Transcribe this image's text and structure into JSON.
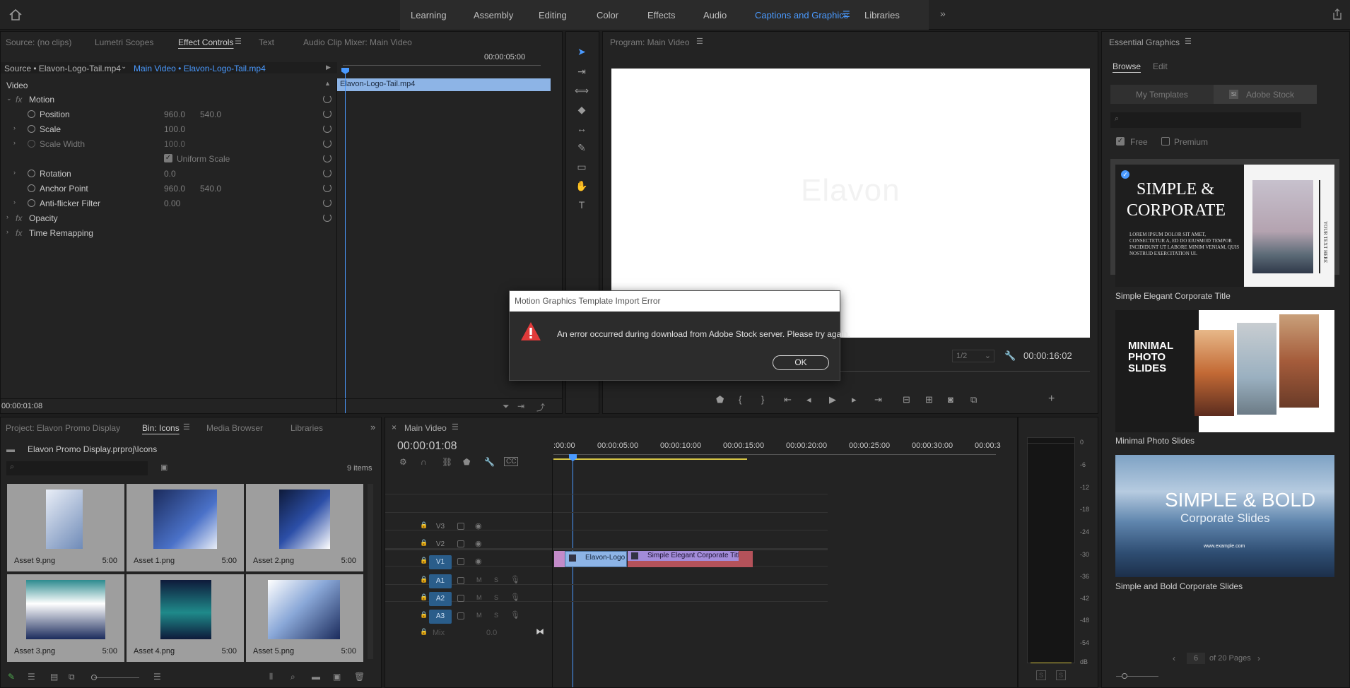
{
  "workspaces": {
    "tabs": [
      "Learning",
      "Assembly",
      "Editing",
      "Color",
      "Effects",
      "Audio",
      "Captions and Graphics",
      "Libraries"
    ],
    "active": "Captions and Graphics"
  },
  "source_panel": {
    "tabs": [
      "Source: (no clips)",
      "Lumetri Scopes",
      "Effect Controls",
      "Text",
      "Audio Clip Mixer: Main Video"
    ],
    "source_label": "Source • Elavon-Logo-Tail.mp4",
    "sequence_label": "Main Video • Elavon-Logo-Tail.mp4",
    "ruler_tc": "00:00:05:00",
    "clip_label": "Elavon-Logo-Tail.mp4",
    "current_tc": "00:00:01:08",
    "video_label": "Video",
    "rows": {
      "motion": "Motion",
      "position": "Position",
      "position_x": "960.0",
      "position_y": "540.0",
      "scale": "Scale",
      "scale_v": "100.0",
      "scale_width": "Scale Width",
      "scale_width_v": "100.0",
      "uniform_scale": "Uniform Scale",
      "rotation": "Rotation",
      "rotation_v": "0.0",
      "anchor": "Anchor Point",
      "anchor_x": "960.0",
      "anchor_y": "540.0",
      "antiflicker": "Anti-flicker Filter",
      "antiflicker_v": "0.00",
      "opacity": "Opacity",
      "time_remap": "Time Remapping"
    }
  },
  "program": {
    "title": "Program: Main Video",
    "watermark": "Elavon",
    "zoom": "1/2",
    "duration_tc": "00:00:16:02"
  },
  "project": {
    "tabs": [
      "Project: Elavon Promo Display",
      "Bin: Icons",
      "Media Browser",
      "Libraries"
    ],
    "path": "Elavon Promo Display.prproj\\Icons",
    "count": "9 items",
    "assets": [
      {
        "name": "Asset 9.png",
        "dur": "5:00"
      },
      {
        "name": "Asset 1.png",
        "dur": "5:00"
      },
      {
        "name": "Asset 2.png",
        "dur": "5:00"
      },
      {
        "name": "Asset 3.png",
        "dur": "5:00"
      },
      {
        "name": "Asset 4.png",
        "dur": "5:00"
      },
      {
        "name": "Asset 5.png",
        "dur": "5:00"
      }
    ]
  },
  "timeline": {
    "title": "Main Video",
    "tc": "00:00:01:08",
    "ruler": [
      ":00:00",
      "00:00:05:00",
      "00:00:10:00",
      "00:00:15:00",
      "00:00:20:00",
      "00:00:25:00",
      "00:00:30:00",
      "00:00:3"
    ],
    "video_tracks": [
      "V3",
      "V2",
      "V1"
    ],
    "audio_tracks": [
      "A1",
      "A2",
      "A3"
    ],
    "mix_label": "Mix",
    "mix_value": "0.0",
    "clip1": "Elavon-Logo",
    "clip2": "Simple Elegant Corporate Title",
    "track_m": "M",
    "track_s": "S"
  },
  "meter": {
    "labels": [
      "0",
      "-6",
      "-12",
      "-18",
      "-24",
      "-30",
      "-36",
      "-42",
      "-48",
      "-54",
      "dB"
    ],
    "solo": "S"
  },
  "essential_graphics": {
    "title": "Essential Graphics",
    "tabs": [
      "Browse",
      "Edit"
    ],
    "sources": [
      "My Templates",
      "Adobe Stock"
    ],
    "stock_badge": "St",
    "filters": [
      "Free",
      "Premium"
    ],
    "templates": [
      {
        "name": "Simple Elegant Corporate Title",
        "line1": "SIMPLE &",
        "line2": "CORPORATE",
        "body": "LOREM IPSUM DOLOR SIT AMET, CONSECTETUR A, ED DO EIUSMOD TEMPOR INCIDIDUNT UT LABORE MINIM VENIAM, QUIS NOSTRUD EXERCITATION UL",
        "side": "YOUR TEXT HERE"
      },
      {
        "name": "Minimal Photo Slides",
        "line1": "MINIMAL",
        "line2": "PHOTO",
        "line3": "SLIDES"
      },
      {
        "name": "Simple and Bold Corporate Slides",
        "line1": "SIMPLE & BOLD",
        "line2": "Corporate Slides",
        "url": "www.example.com"
      }
    ],
    "page": "6",
    "of_pages": "of 20 Pages"
  },
  "dialog": {
    "title": "Motion Graphics Template Import Error",
    "message": "An error occurred during download from Adobe Stock server. Please try again.",
    "ok": "OK"
  },
  "colors": {
    "accent": "#4a9aff",
    "clip_blue": "#8db4e6",
    "clip_pink": "#c38bc9",
    "clip_purple": "#a38cd9",
    "clip_red": "#b4525a",
    "error_red": "#e03a3a"
  }
}
